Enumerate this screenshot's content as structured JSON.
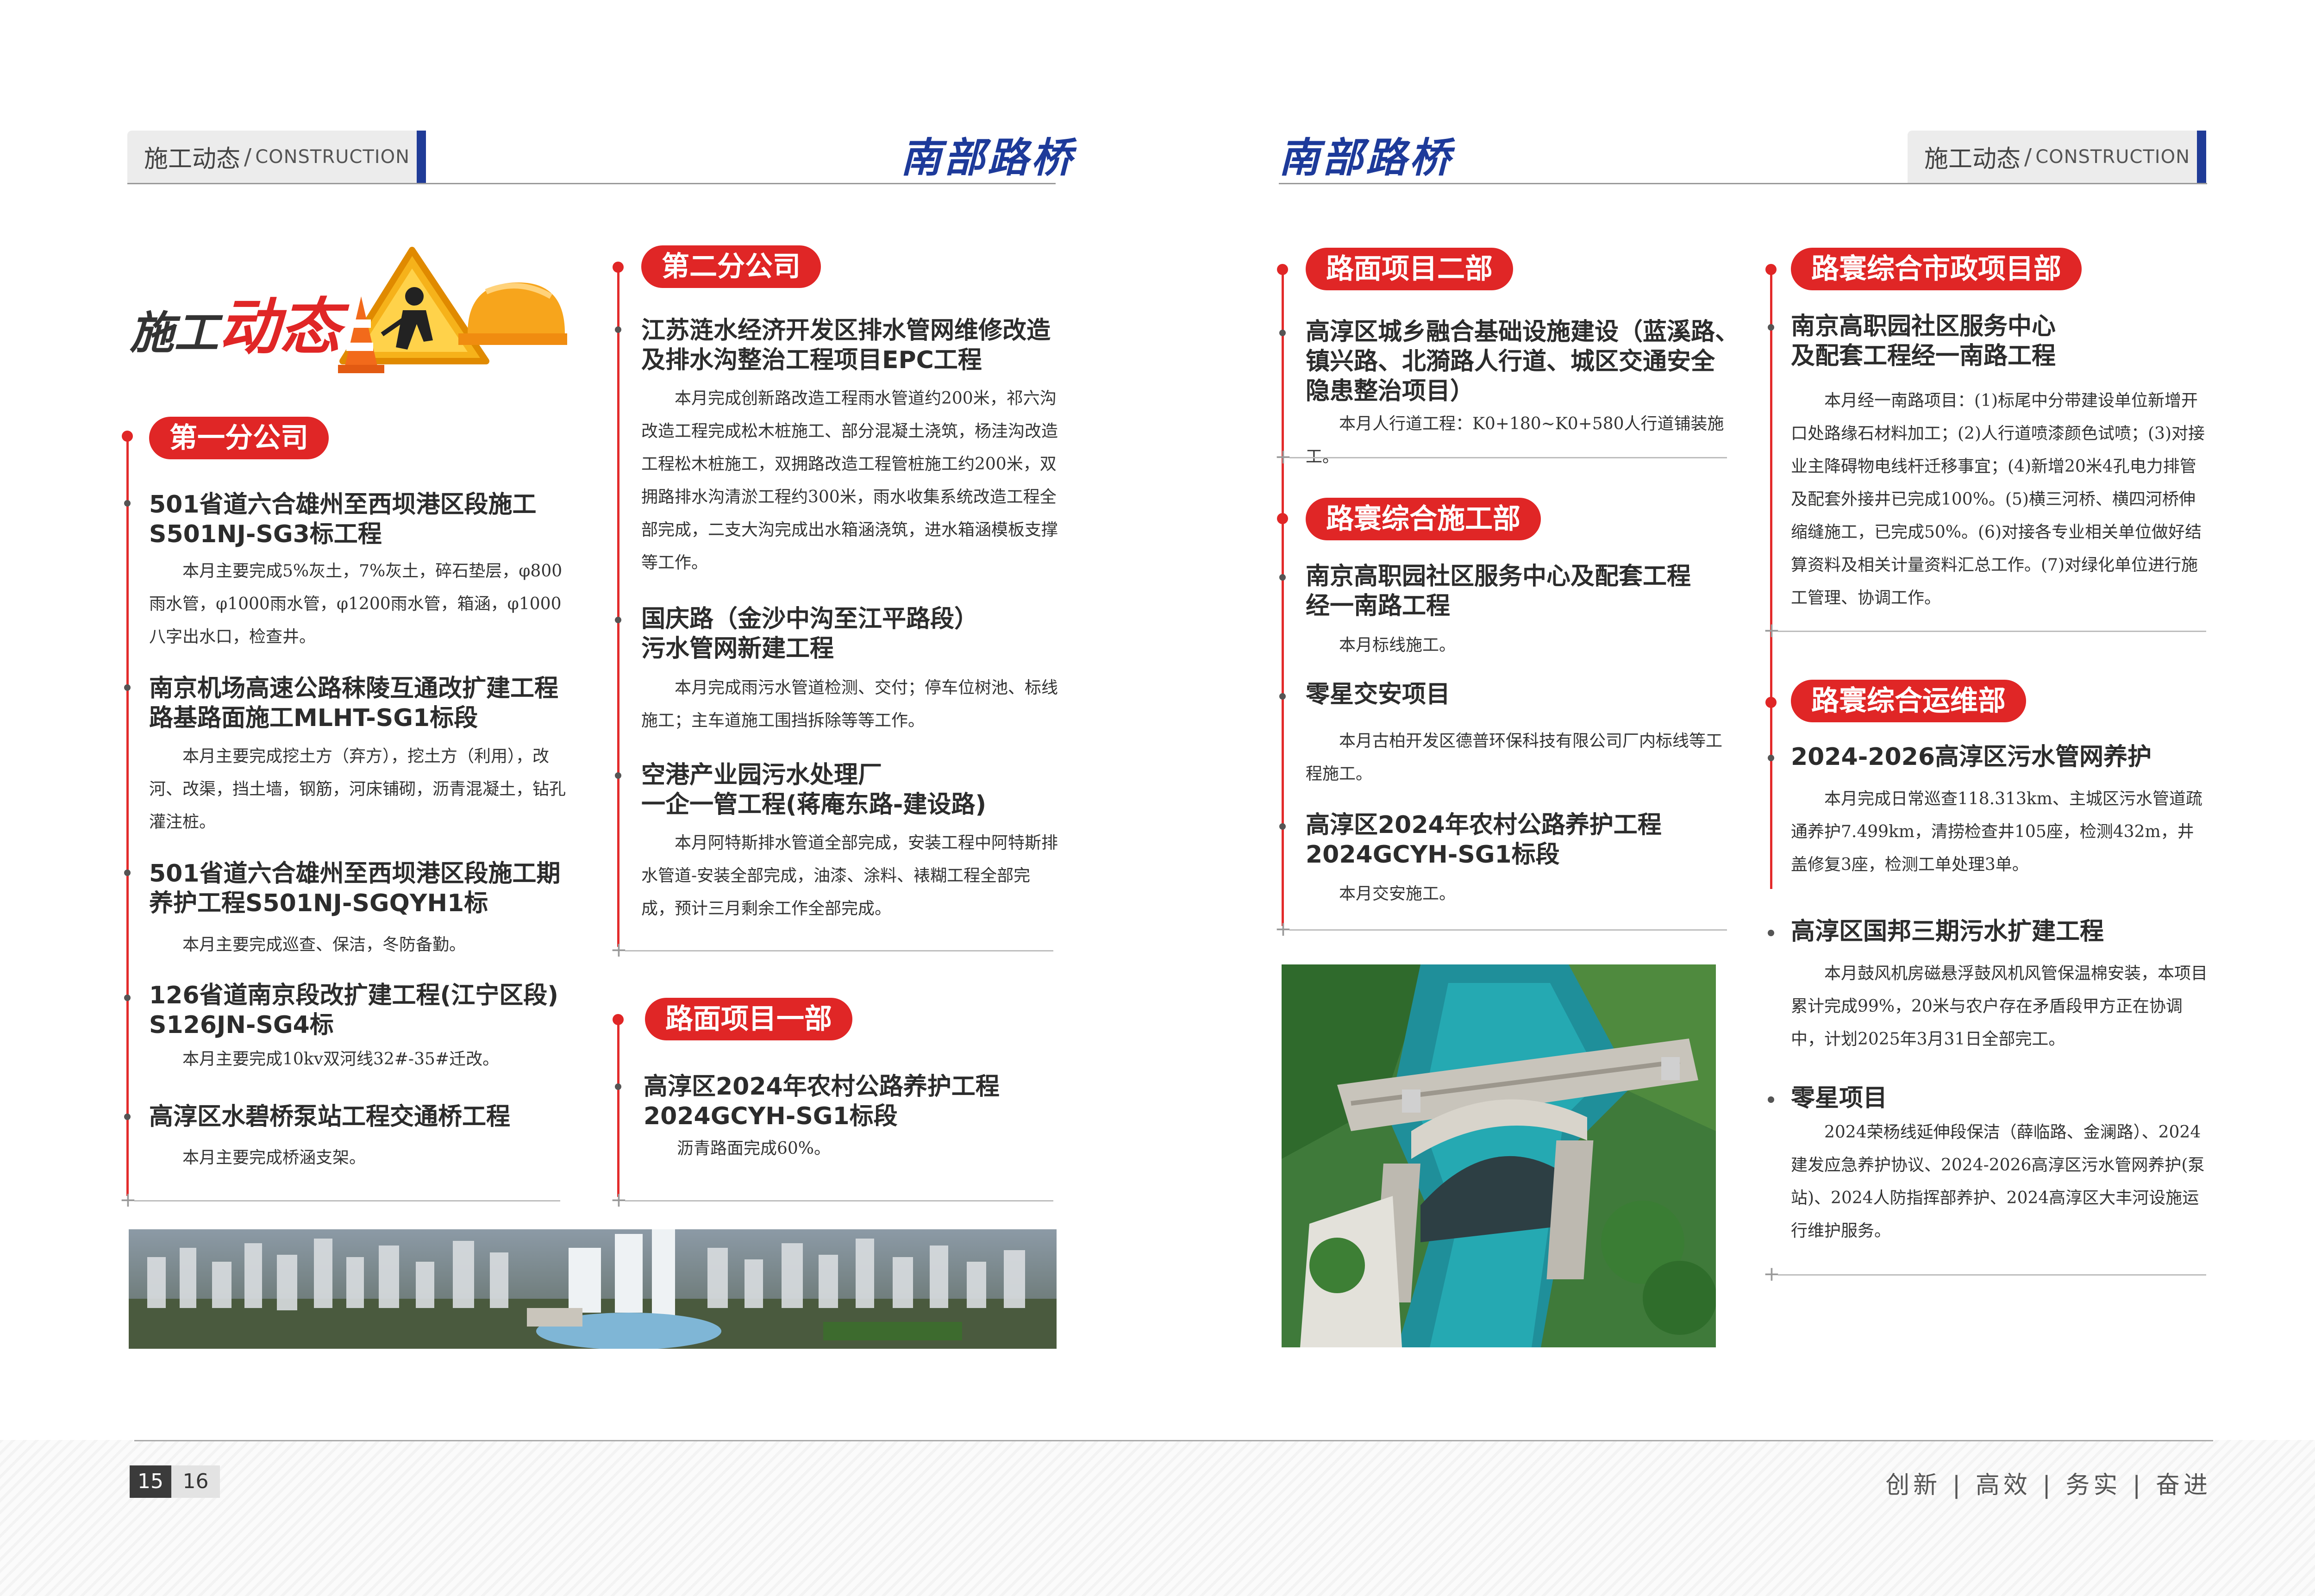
{
  "header": {
    "section_cn": "施工动态",
    "separator": "/",
    "section_en": "CONSTRUCTION",
    "brand": "南部路桥"
  },
  "title": {
    "part1": "施工",
    "part2": "动态"
  },
  "left_col1": {
    "company": "第一分公司",
    "items": [
      {
        "title": "501省道六合雄州至西坝港区段施工\nS501NJ-SG3标工程",
        "body": "本月主要完成5%灰土，7%灰土，碎石垫层，φ800雨水管，φ1000雨水管，φ1200雨水管，箱涵，φ1000八字出水口，检查井。"
      },
      {
        "title": "南京机场高速公路秣陵互通改扩建工程\n路基路面施工MLHT-SG1标段",
        "body": "本月主要完成挖土方（弃方），挖土方（利用），改河、改渠，挡土墙，钢筋，河床铺砌，沥青混凝土，钻孔灌注桩。"
      },
      {
        "title": "501省道六合雄州至西坝港区段施工期\n养护工程S501NJ-SGQYH1标",
        "body": "本月主要完成巡查、保洁，冬防备勤。"
      },
      {
        "title": "126省道南京段改扩建工程(江宁区段)\nS126JN-SG4标",
        "body": "本月主要完成10kv双河线32#-35#迁改。"
      },
      {
        "title": "高淳区水碧桥泵站工程交通桥工程",
        "body": "本月主要完成桥涵支架。"
      }
    ]
  },
  "left_col2": {
    "company": "第二分公司",
    "items": [
      {
        "title": "江苏涟水经济开发区排水管网维修改造\n及排水沟整治工程项目EPC工程",
        "body": "本月完成创新路改造工程雨水管道约200米，祁六沟改造工程完成松木桩施工、部分混凝土浇筑，杨洼沟改造工程松木桩施工，双拥路改造工程管桩施工约200米，双拥路排水沟清淤工程约300米，雨水收集系统改造工程全部完成，二支大沟完成出水箱涵浇筑，进水箱涵模板支撑等工作。"
      },
      {
        "title": "国庆路（金沙中沟至江平路段）\n污水管网新建工程",
        "body": "本月完成雨污水管道检测、交付；停车位树池、标线施工；主车道施工围挡拆除等等工作。"
      },
      {
        "title": "空港产业园污水处理厂\n一企一管工程(蒋庵东路-建设路)",
        "body": "本月阿特斯排水管道全部完成，安装工程中阿特斯排水管道-安装全部完成，油漆、涂料、裱糊工程全部完成，预计三月剩余工作全部完成。"
      }
    ],
    "dept": "路面项目一部",
    "dept_items": [
      {
        "title": "高淳区2024年农村公路养护工程\n2024GCYH-SG1标段",
        "body": "沥青路面完成60%。"
      }
    ]
  },
  "right_col1": {
    "dept1": "路面项目二部",
    "items1": [
      {
        "title": "高淳区城乡融合基础设施建设（蓝溪路、\n镇兴路、北漪路人行道、城区交通安全\n隐患整治项目）",
        "body": "本月人行道工程：K0+180~K0+580人行道铺装施工。"
      }
    ],
    "dept2": "路寰综合施工部",
    "items2": [
      {
        "title": "南京高职园社区服务中心及配套工程\n经一南路工程",
        "body": "本月标线施工。"
      },
      {
        "title": "零星交安项目",
        "body": "本月古柏开发区德普环保科技有限公司厂内标线等工程施工。"
      },
      {
        "title": "高淳区2024年农村公路养护工程\n2024GCYH-SG1标段",
        "body": "本月交安施工。"
      }
    ]
  },
  "right_col2": {
    "dept1": "路寰综合市政项目部",
    "items1": [
      {
        "title": "南京高职园社区服务中心\n及配套工程经一南路工程",
        "body": "本月经一南路项目：(1)标尾中分带建设单位新增开口处路缘石材料加工；(2)人行道喷漆颜色试喷；(3)对接业主降碍物电线杆迁移事宜；(4)新增20米4孔电力排管及配套外接井已完成100%。(5)横三河桥、横四河桥伸缩缝施工，已完成50%。(6)对接各专业相关单位做好结算资料及相关计量资料汇总工作。(7)对绿化单位进行施工管理、协调工作。"
      }
    ],
    "dept2": "路寰综合运维部",
    "items2": [
      {
        "title": "2024-2026高淳区污水管网养护",
        "body": "本月完成日常巡查118.313km、主城区污水管道疏通养护7.499km，清捞检查井105座，检测432m，井盖修复3座，检测工单处理3单。"
      },
      {
        "title": "高淳区国邦三期污水扩建工程",
        "body": "本月鼓风机房磁悬浮鼓风机风管保温棉安装，本项目累计完成99%，20米与农户存在矛盾段甲方正在协调中，计划2025年3月31日全部完工。"
      },
      {
        "title": "零星项目",
        "body": "2024荣杨线延伸段保洁（薛临路、金澜路）、2024建发应急养护协议、2024-2026高淳区污水管网养护(泵站)、2024人防指挥部养护、2024高淳区大丰河设施运行维护服务。"
      }
    ]
  },
  "footer": {
    "page_left": "15",
    "page_right": "16",
    "slogan": "创新 | 高效 | 务实 | 奋进"
  },
  "colors": {
    "accent_red": "#e02626",
    "brand_blue": "#1d3a9a"
  }
}
